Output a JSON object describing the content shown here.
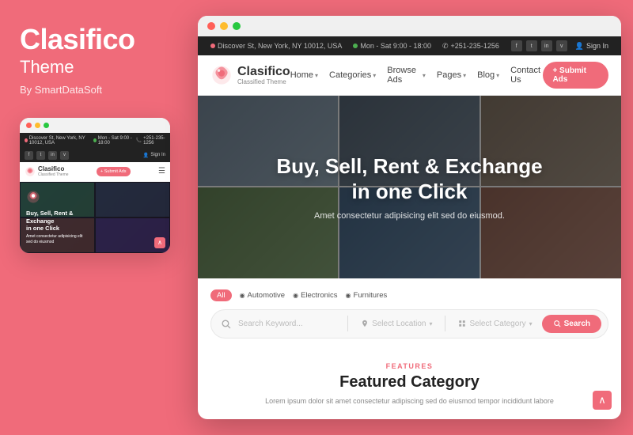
{
  "left": {
    "title": "Clasifico",
    "subtitle": "Theme",
    "by": "By SmartDataSoft",
    "mini_browser": {
      "topbar": {
        "address": "Discover St, New York, NY 10012, USA",
        "hours": "Mon - Sat 9:00 - 18:00",
        "phone": "+251-235-1256",
        "signin": "Sign In"
      },
      "nav": {
        "logo_text": "Clasifico",
        "logo_sub": "Classified Theme",
        "submit_btn": "+ Submit Ads"
      },
      "hero": {
        "title": "Buy, Sell, Rent &\nExchange\nin one Click",
        "subtitle": "Amet consectetur adipisicing elit\nsed do eiusmod"
      }
    }
  },
  "right": {
    "browser": {
      "topbar": {
        "address": "Discover St, New York, NY 10012, USA",
        "hours": "Mon - Sat 9:00 - 18:00",
        "phone": "+251-235-1256",
        "signin": "Sign In",
        "social": [
          "f",
          "t",
          "in",
          "v"
        ]
      },
      "nav": {
        "logo_text": "Clasifico",
        "logo_sub": "Classified Theme",
        "links": [
          "Home",
          "Categories",
          "Browse Ads",
          "Pages",
          "Blog",
          "Contact Us"
        ],
        "submit_btn": "+ Submit Ads"
      },
      "hero": {
        "title": "Buy, Sell, Rent & Exchange\nin one Click",
        "subtitle": "Amet consectetur adipisicing elit sed do eiusmod."
      },
      "search": {
        "filter_tabs": [
          "All",
          "Automotive",
          "Electronics",
          "Furnitures"
        ],
        "active_tab": "All",
        "keyword_placeholder": "Search Keyword...",
        "location_placeholder": "Select Location",
        "category_placeholder": "Select Category",
        "search_btn": "Search"
      },
      "features": {
        "label": "FEATURES",
        "title": "Featured Category",
        "desc": "Lorem ipsum dolor sit amet consectetur adipiscing sed do eiusmod tempor incididunt labore"
      }
    }
  }
}
